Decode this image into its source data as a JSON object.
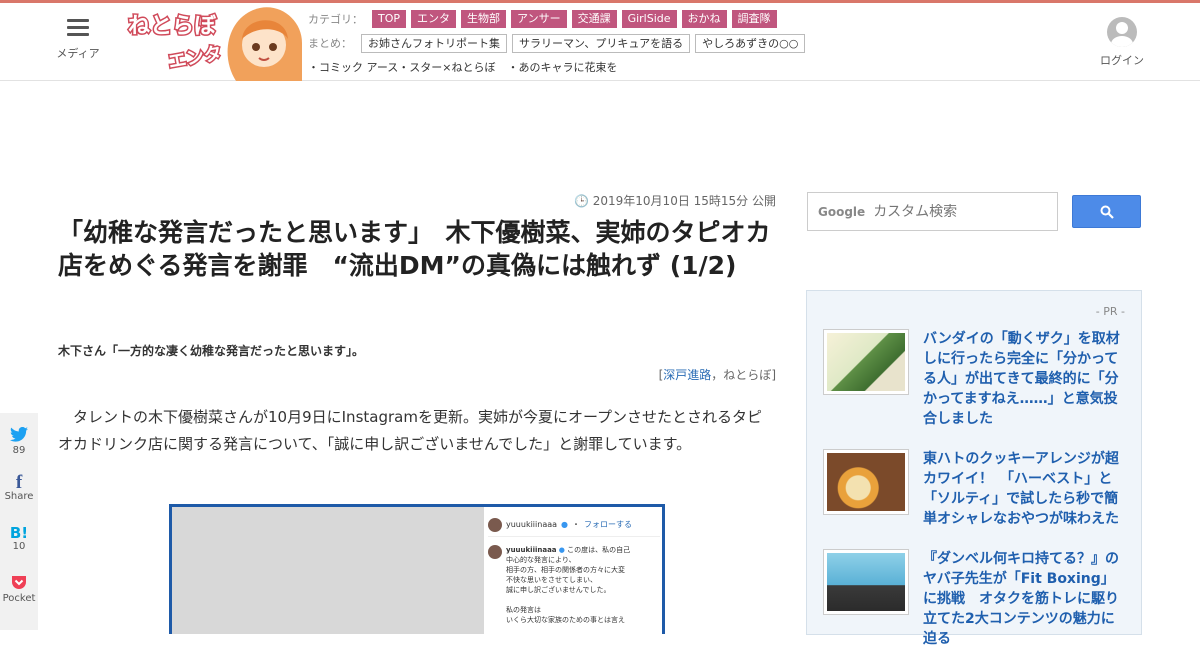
{
  "header": {
    "menu_label": "メディア",
    "logo_text": "ねとらぼ エンタ",
    "category_label": "カテゴリ：",
    "categories": [
      "TOP",
      "エンタ",
      "生物部",
      "アンサー",
      "交通課",
      "GirlSide",
      "おかね",
      "調査隊"
    ],
    "matome_label": "まとめ：",
    "matome": [
      "お姉さんフォトリポート集",
      "サラリーマン、プリキュアを語る",
      "やしろあずきの○○"
    ],
    "links": [
      "・コミック アース・スター×ねとらぼ",
      "・あのキャラに花束を"
    ],
    "login_label": "ログイン"
  },
  "article": {
    "date": "2019年10月10日 15時15分 公開",
    "title": "「幼稚な発言だったと思います」　木下優樹菜、実姉のタピオカ店をめぐる発言を謝罪　“流出DM”の真偽には触れず (1/2)",
    "subtitle": "木下さん「一方的な凄く幼稚な発言だったと思います」。",
    "byline_open": "[",
    "author": "深戸進路",
    "byline_sep": "，",
    "outlet": "ねとらぼ",
    "byline_close": "]",
    "body": "タレントの木下優樹菜さんが10月9日にInstagramを更新。実姉が今夏にオープンさせたとされるタピオカドリンク店に関する発言について、「誠に申し訳ございませんでした」と謝罪しています。"
  },
  "figure": {
    "ig_user": "yuuukiiinaaa",
    "ig_follow": "フォローする",
    "ig_lines": [
      "この度は、私の自己",
      "中心的な発言により、",
      "相手の方、相手の関係者の方々に大変",
      "不快な思いをさせてしまい、",
      "誠に申し訳ございませんでした。",
      "",
      "私の発言は",
      "いくら大切な家族のための事とは言え"
    ]
  },
  "share": [
    {
      "icon": "twitter-icon",
      "glyph": "🐦",
      "count": "89"
    },
    {
      "icon": "facebook-icon",
      "glyph": "f",
      "count": "Share"
    },
    {
      "icon": "hatena-icon",
      "glyph": "B!",
      "count": "10"
    },
    {
      "icon": "pocket-icon",
      "glyph": "⌄",
      "count": "Pocket"
    }
  ],
  "sidebar": {
    "search_brand": "Google",
    "search_placeholder": "カスタム検索",
    "pr_label": "- PR -",
    "pr_items": [
      {
        "text": "バンダイの「動くザク」を取材しに行ったら完全に「分かってる人」が出てきて最終的に「分かってますねえ……」と意気投合しました"
      },
      {
        "text": "東ハトのクッキーアレンジが超カワイイ！　「ハーベスト」と「ソルティ」で試したら秒で簡単オシャレなおやつが味わえた"
      },
      {
        "text": "『ダンベル何キロ持てる？』のヤバ子先生が「Fit Boxing」に挑戦　オタクを筋トレに駆り立てた2大コンテンツの魅力に迫る"
      }
    ]
  },
  "colors": {
    "accent": "#d9776a",
    "category_bg": "#c0567e",
    "link": "#2a6cb5",
    "search_button": "#4d8be8"
  }
}
